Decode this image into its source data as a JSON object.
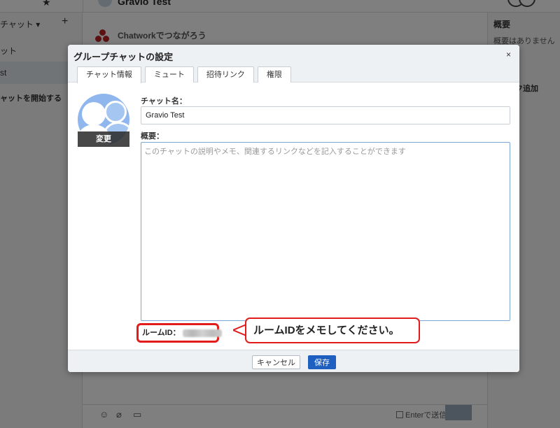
{
  "app": {
    "room_title": "Gravio Test",
    "sidebar": {
      "filter_label": "チャット ▾",
      "add_symbol": "+",
      "item_partial": "ット",
      "active_item_partial": "st",
      "start_chat_partial": "ャットを開始する"
    },
    "banner": {
      "title": "Chatworkでつながろう"
    },
    "right_pane": {
      "heading": "概要",
      "empty_text": "概要はありません",
      "task_add_partial": "スク追加"
    },
    "composer": {
      "enter_send_label": "Enterで送信"
    }
  },
  "dialog": {
    "title": "グループチャットの設定",
    "close_symbol": "×",
    "tabs": [
      {
        "label": "チャット情報",
        "active": true
      },
      {
        "label": "ミュート",
        "active": false
      },
      {
        "label": "招待リンク",
        "active": false
      },
      {
        "label": "権限",
        "active": false
      }
    ],
    "avatar_change_label": "変更",
    "chat_name_label": "チャット名：",
    "chat_name_value": "Gravio Test",
    "description_label": "概要：",
    "description_placeholder": "このチャットの説明やメモ、関連するリンクなどを記入することができます",
    "description_value": "",
    "room_id_label": "ルームID：",
    "callout_text": "ルームIDをメモしてください。",
    "cancel_label": "キャンセル",
    "save_label": "保存"
  },
  "colors": {
    "highlight_red": "#e21b1b",
    "save_blue": "#1f5fbf",
    "avatar_blue": "#8fb7ee"
  }
}
